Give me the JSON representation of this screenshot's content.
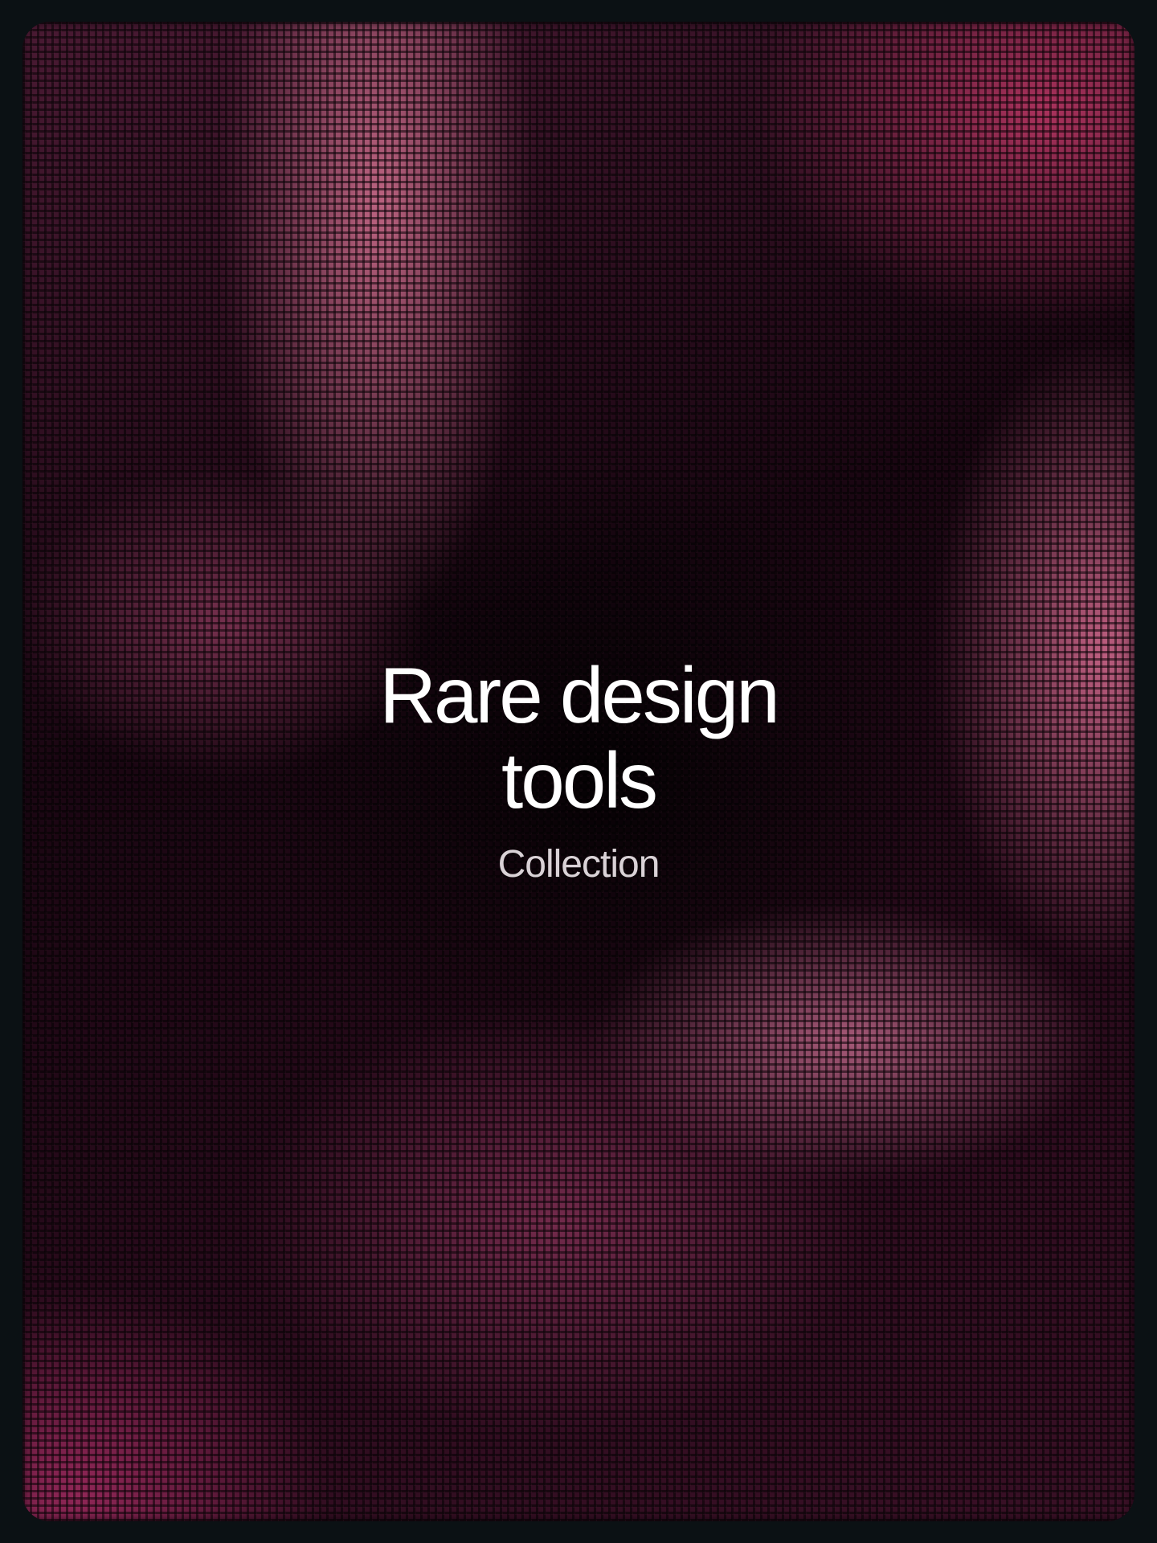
{
  "cover": {
    "title_line1": "Rare design",
    "title_line2": "tools",
    "subtitle": "Collection"
  },
  "colors": {
    "page_background": "#0b1114",
    "accent_pink": "#c46886",
    "accent_crimson": "#b23460",
    "title_text": "#ffffff",
    "subtitle_text": "#d9d2d6"
  }
}
